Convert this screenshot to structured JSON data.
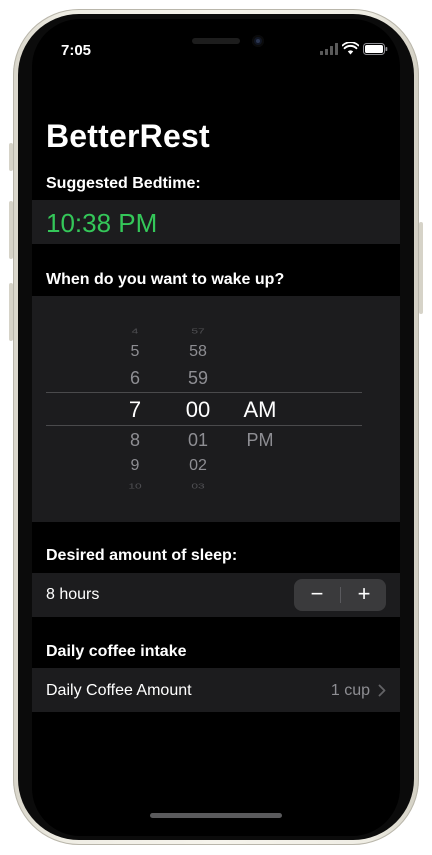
{
  "status_bar": {
    "time": "7:05"
  },
  "app": {
    "title": "BetterRest"
  },
  "bedtime": {
    "label": "Suggested Bedtime:",
    "value": "10:38 PM",
    "color": "#34c759"
  },
  "wake": {
    "label": "When do you want to wake up?",
    "hours": [
      "4",
      "5",
      "6",
      "7",
      "8",
      "9",
      "10"
    ],
    "minutes": [
      "57",
      "58",
      "59",
      "00",
      "01",
      "02",
      "03"
    ],
    "periods": [
      "AM",
      "PM"
    ],
    "selected": {
      "hour": "7",
      "minute": "00",
      "period": "AM"
    }
  },
  "sleep": {
    "label": "Desired amount of sleep:",
    "value": "8 hours",
    "decrement": "−",
    "increment": "+"
  },
  "coffee": {
    "section_label": "Daily coffee intake",
    "row_label": "Daily Coffee Amount",
    "value": "1 cup"
  }
}
